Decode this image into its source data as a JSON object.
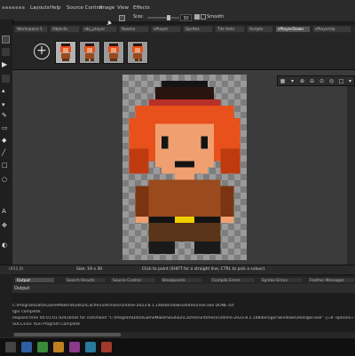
{
  "menu": {
    "items": [
      "Layouts",
      "Help",
      "Source Control",
      "Image",
      "View",
      "Effects"
    ]
  },
  "toolbar": {
    "size_label": "Size:",
    "size_value": "30",
    "smooth_label": "Smooth"
  },
  "tabs": [
    {
      "label": "Workspace 1"
    },
    {
      "label": "Objects"
    },
    {
      "label": "obj_player"
    },
    {
      "label": "Rooms"
    },
    {
      "label": "sPlayer"
    },
    {
      "label": "Sprites"
    },
    {
      "label": "Tile Sets"
    },
    {
      "label": "Scripts"
    },
    {
      "label": "sPlayerDown",
      "active": true
    },
    {
      "label": "sPlayerUp"
    }
  ],
  "frames": {
    "count": 4,
    "add_label": "+"
  },
  "status": {
    "coords_left": "(451,0)",
    "size": "Size: 19 x 30",
    "hint": "Click to paint (SHIFT for a straight line, CTRL to pick a colour)"
  },
  "output": {
    "tabs": [
      "Output",
      "Search Results",
      "Source Control",
      "Breakpoints",
      "Compile Errors",
      "Syntax Errors",
      "Feather Messages"
    ],
    "header": "Output",
    "lines": [
      "C:\\ProgramData\\GameMakerStudio2\\Cache\\runtimes\\runtime-2023.8.1.148\\windows\\x64\\Runner.exe DONE (0)",
      "Igor complete.",
      "elapsed time 00:01:01.9241850s for command \"C:\\ProgramData\\GameMakerStudio2\\Cache\\runtimes\\runtime-2023.8.1.148\\bin\\igor\\windows\\x64\\Igor.exe\" -j=8 -options=\"C:\\Users\\comp",
      "SUCCESS: Run Program Complete"
    ]
  },
  "colors": {
    "hair": "#e8501c",
    "hair_dark": "#c03a10",
    "skin": "#f0a070",
    "hat": "#2a1410",
    "hat_band": "#b8302a",
    "shirt": "#9a4a1c",
    "shirt_dark": "#7a3412",
    "buckle": "#f0d000",
    "pants": "#5a3418",
    "boots": "#1a1a1a",
    "outline": "#141414"
  }
}
